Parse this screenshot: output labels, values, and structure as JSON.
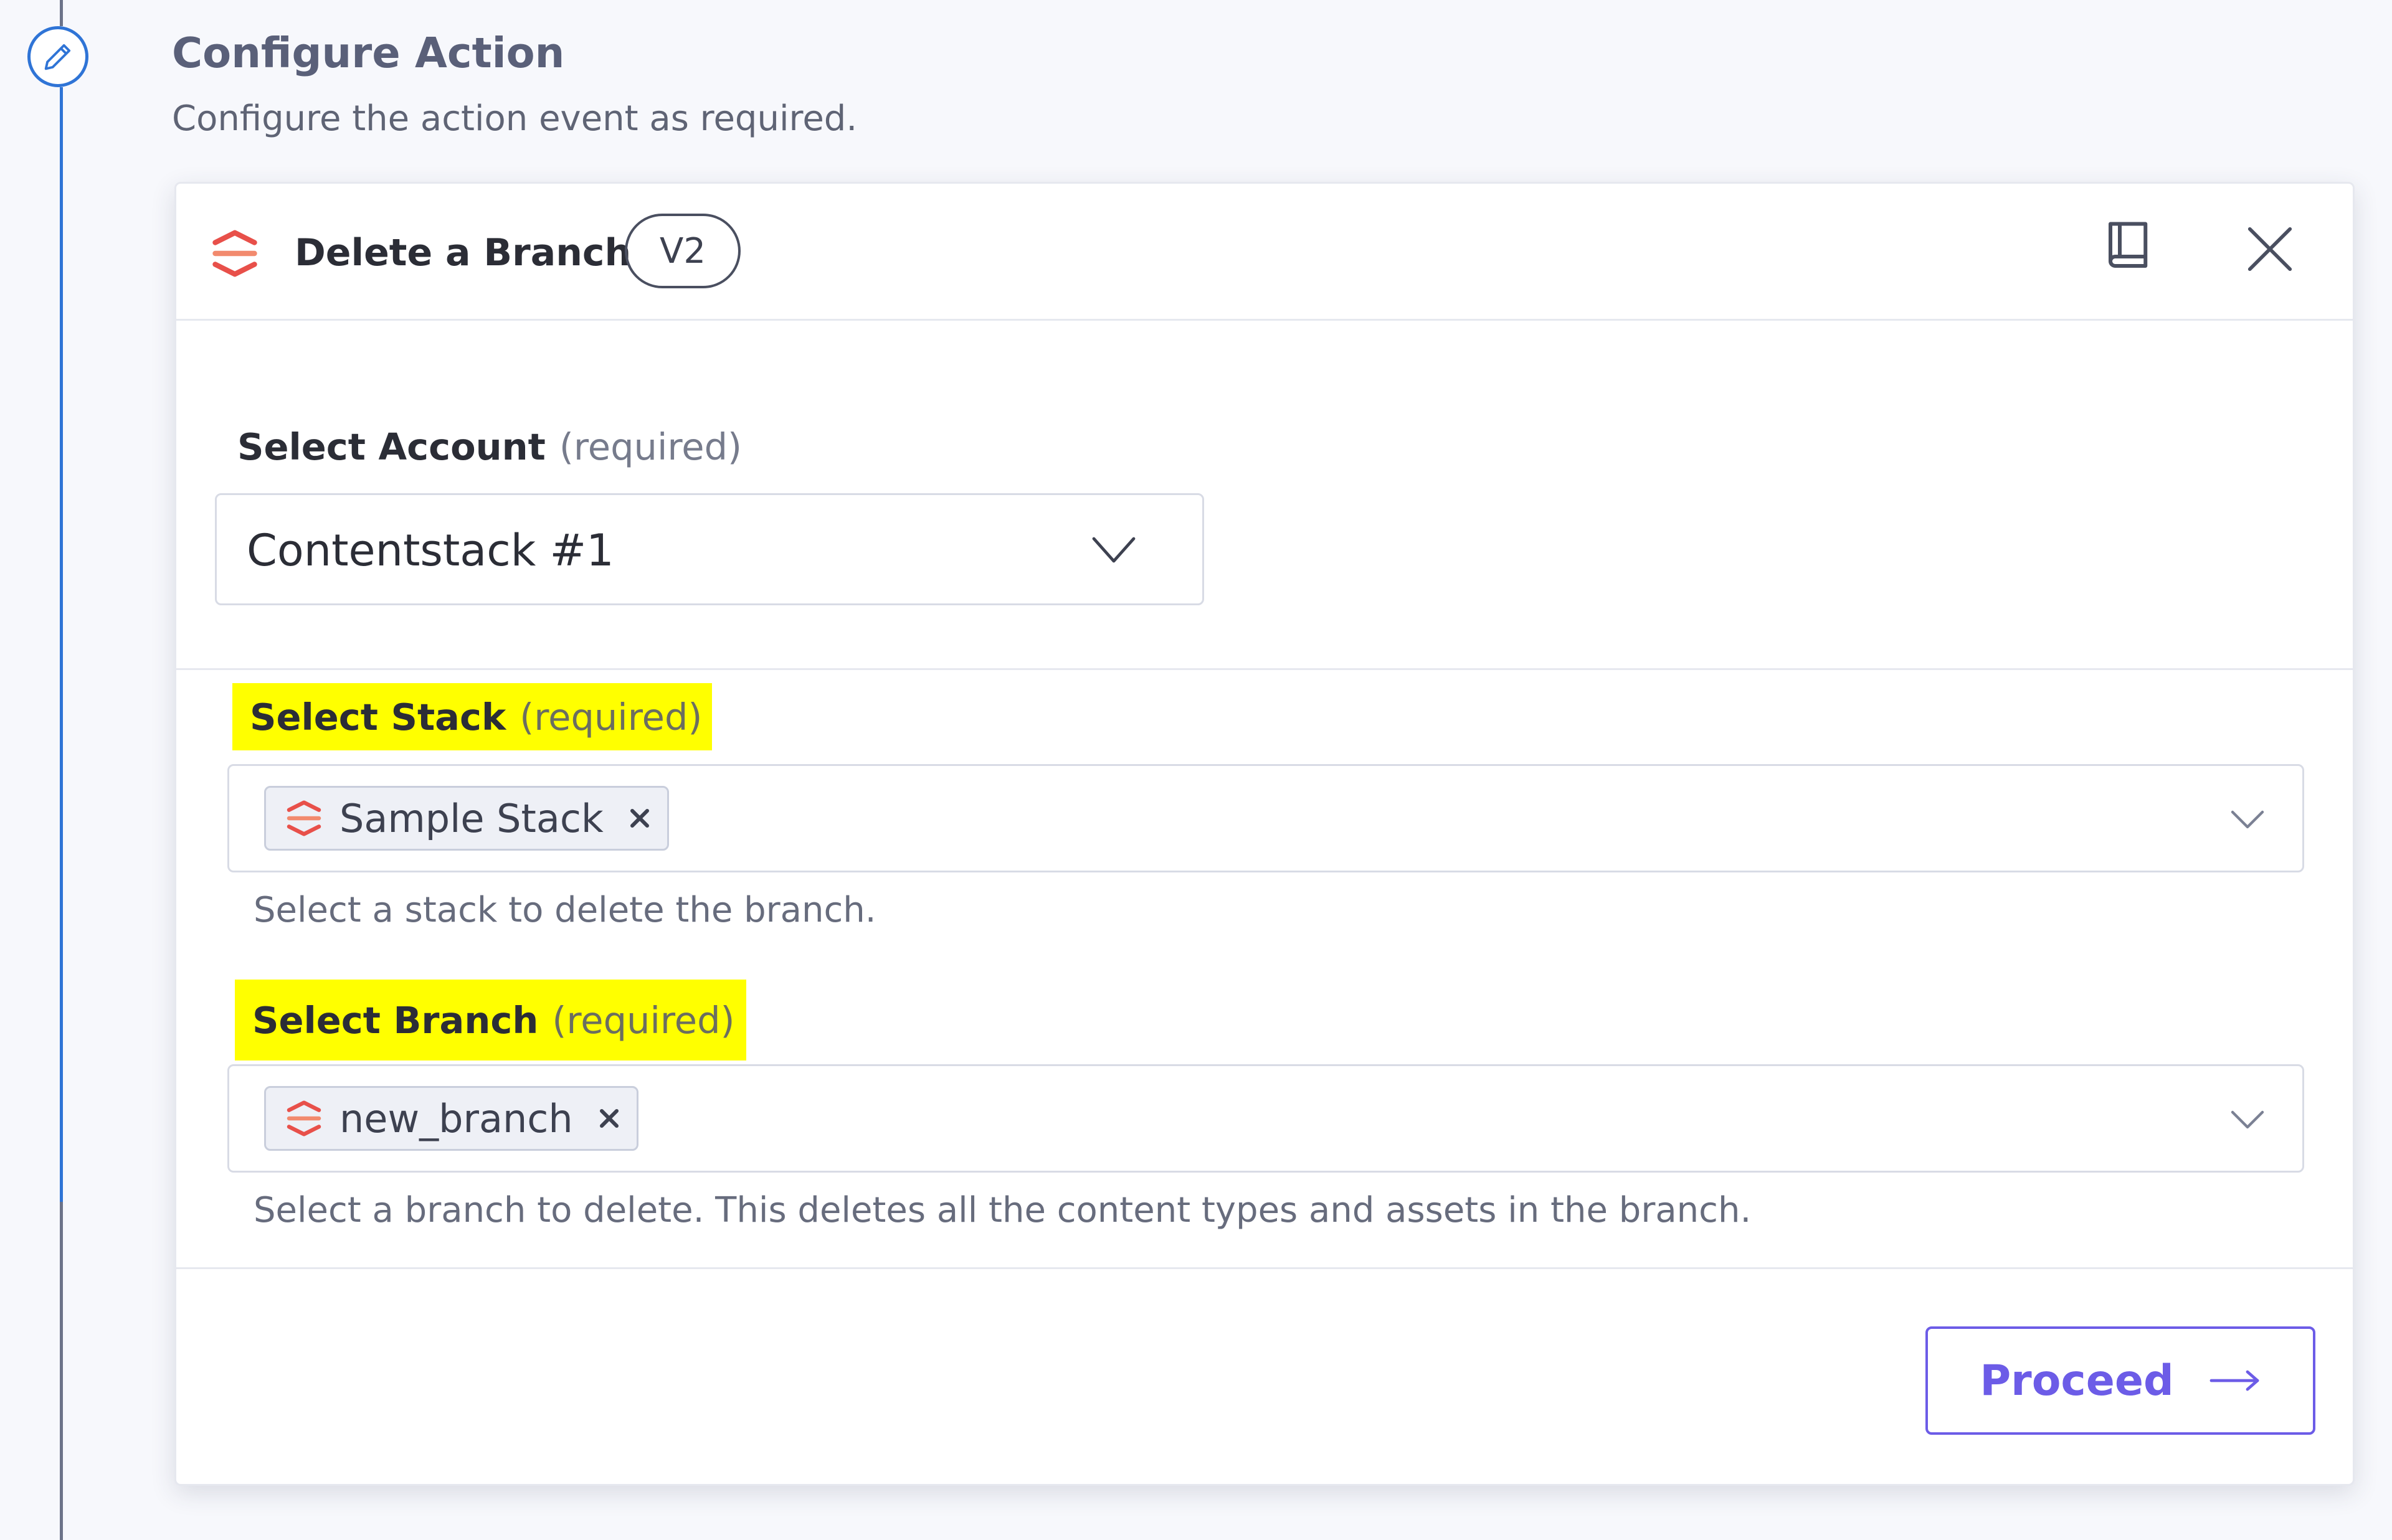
{
  "section": {
    "title": "Configure Action",
    "subtitle": "Configure the action event as required."
  },
  "action": {
    "name": "Delete a Branch",
    "version": "V2",
    "icons": {
      "app": "contentstack-logo-icon",
      "docs": "book-icon",
      "close": "close-icon",
      "step": "pencil-icon"
    }
  },
  "fields": {
    "account": {
      "label": "Select Account",
      "required": "(required)",
      "value": "Contentstack #1"
    },
    "stack": {
      "label": "Select Stack",
      "required": "(required)",
      "selected": "Sample Stack",
      "helper": "Select a stack to delete the branch."
    },
    "branch": {
      "label": "Select Branch",
      "required": "(required)",
      "selected": "new_branch",
      "helper": "Select a branch to delete. This deletes all the content types and assets in the branch."
    }
  },
  "footer": {
    "proceed_label": "Proceed"
  },
  "colors": {
    "accent": "#6c5ce7",
    "timeline": "#2f74d6",
    "highlight": "#ffff00",
    "brand": "#e8504a"
  }
}
